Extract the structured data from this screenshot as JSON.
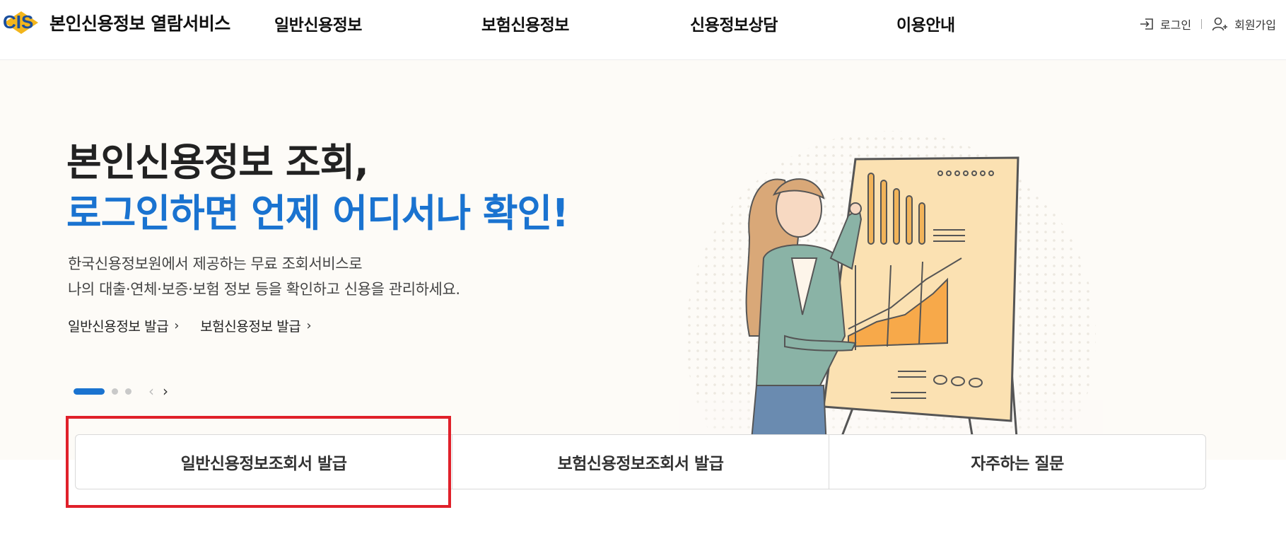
{
  "header": {
    "site_title": "본인신용정보 열람서비스",
    "logo_alt": "CIS",
    "nav": [
      "일반신용정보",
      "보험신용정보",
      "신용정보상담",
      "이용안내"
    ],
    "login_label": "로그인",
    "signup_label": "회원가입",
    "icons": {
      "login": "login-icon",
      "signup": "user-add-icon"
    }
  },
  "hero": {
    "title_line1": "본인신용정보 조회,",
    "title_line2": "로그인하면 언제 어디서나 확인!",
    "desc_line1": "한국신용정보원에서 제공하는 무료 조회서비스로",
    "desc_line2": "나의 대출·연체·보증·보험 정보 등을 확인하고 신용을 관리하세요.",
    "links": [
      "일반신용정보 발급",
      "보험신용정보 발급"
    ],
    "slide_dots": 3,
    "active_slide": 1
  },
  "quick_menu": [
    "일반신용정보조회서 발급",
    "보험신용정보조회서 발급",
    "자주하는 질문"
  ],
  "colors": {
    "accent": "#1a73d0",
    "hero_bg": "#fdfbf7",
    "highlight": "#e0202a"
  }
}
